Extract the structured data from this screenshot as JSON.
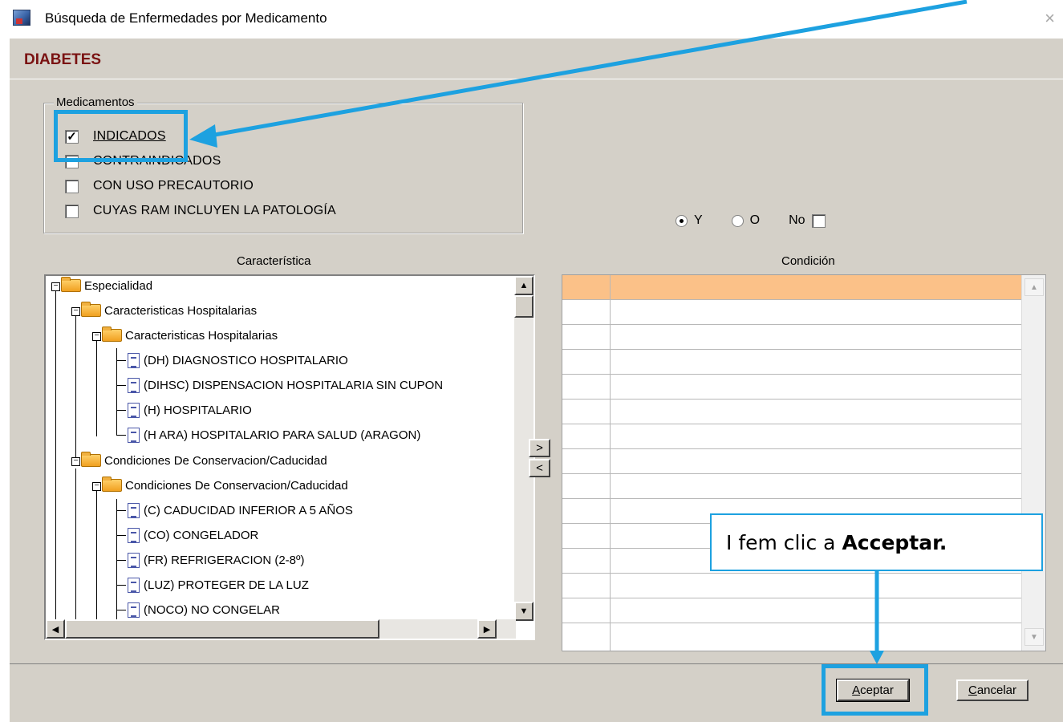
{
  "window": {
    "title": "Búsqueda de Enfermedades por Medicamento",
    "close": "×",
    "disease": "DIABETES"
  },
  "medicamentos": {
    "legend": "Medicamentos",
    "options": [
      {
        "label": "INDICADOS",
        "checked": true,
        "mark": "✓"
      },
      {
        "label": "CONTRAINDICADOS",
        "checked": false,
        "mark": ""
      },
      {
        "label": "CON USO PRECAUTORIO",
        "checked": false,
        "mark": ""
      },
      {
        "label": "CUYAS RAM INCLUYEN LA PATOLOGÍA",
        "checked": false,
        "mark": ""
      }
    ]
  },
  "logic": {
    "y_label": "Y",
    "o_label": "O",
    "no_label": "No",
    "selected": "Y"
  },
  "columns": {
    "caracteristica": "Característica",
    "condicion": "Condición"
  },
  "tree": {
    "nodes": [
      "Especialidad",
      "Caracteristicas Hospitalarias",
      "Caracteristicas Hospitalarias",
      "(DH) DIAGNOSTICO HOSPITALARIO",
      "(DIHSC) DISPENSACION HOSPITALARIA SIN CUPON",
      "(H) HOSPITALARIO",
      "(H ARA) HOSPITALARIO PARA SALUD (ARAGON)",
      "Condiciones De Conservacion/Caducidad",
      "Condiciones De Conservacion/Caducidad",
      "(C) CADUCIDAD INFERIOR A 5 AÑOS",
      "(CO) CONGELADOR",
      "(FR) REFRIGERACION (2-8º)",
      "(LUZ) PROTEGER DE LA LUZ",
      "(NOCO) NO CONGELAR"
    ]
  },
  "transfer": {
    "add": ">",
    "remove": "<"
  },
  "buttons": {
    "aceptar": "Aceptar",
    "aceptar_mnemonic": "A",
    "aceptar_rest": "ceptar",
    "cancelar_mnemonic": "C",
    "cancelar_rest": "ancelar"
  },
  "callout": {
    "text": "I fem clic a",
    "bold": "Acceptar."
  },
  "colors": {
    "annotation": "#1da1e0",
    "grid_header": "#fbc188",
    "disease_title": "#7a1212"
  }
}
